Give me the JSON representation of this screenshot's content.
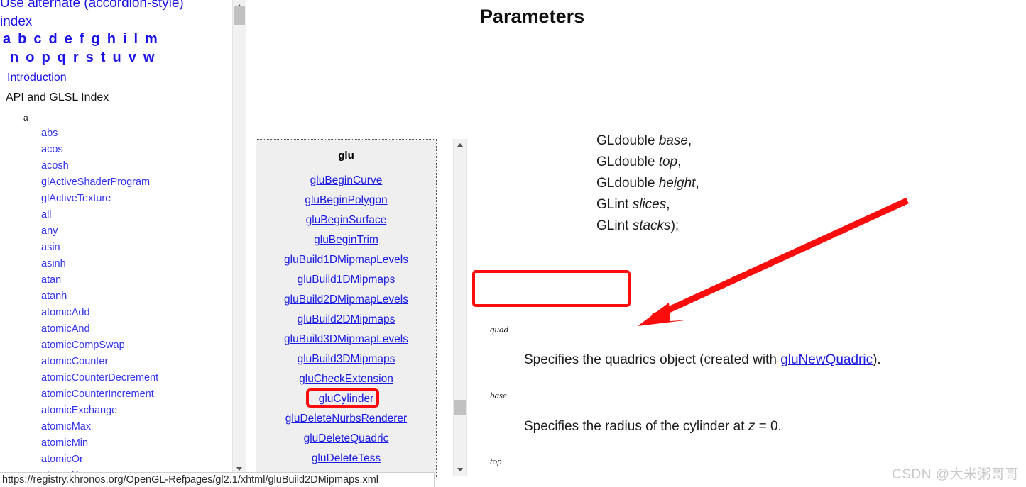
{
  "left_index": {
    "heading_lines": [
      "Use alternate (accordion-style)",
      "index"
    ],
    "alpha_row_1": [
      "a",
      "b",
      "c",
      "d",
      "e",
      "f",
      "g",
      "h",
      "i",
      "l",
      "m"
    ],
    "alpha_row_2": [
      "n",
      "o",
      "p",
      "q",
      "r",
      "s",
      "t",
      "u",
      "v",
      "w"
    ],
    "intro_link": "Introduction",
    "section_title": "API and GLSL Index",
    "letter_group": "a",
    "items": [
      "abs",
      "acos",
      "acosh",
      "glActiveShaderProgram",
      "glActiveTexture",
      "all",
      "any",
      "asin",
      "asinh",
      "atan",
      "atanh",
      "atomicAdd",
      "atomicAnd",
      "atomicCompSwap",
      "atomicCounter",
      "atomicCounterDecrement",
      "atomicCounterIncrement",
      "atomicExchange",
      "atomicMax",
      "atomicMin",
      "atomicOr",
      "atomicXor"
    ]
  },
  "glu_panel": {
    "title": "glu",
    "items": [
      "gluBeginCurve",
      "gluBeginPolygon",
      "gluBeginSurface",
      "gluBeginTrim",
      "gluBuild1DMipmapLevels",
      "gluBuild1DMipmaps",
      "gluBuild2DMipmapLevels",
      "gluBuild2DMipmaps",
      "gluBuild3DMipmapLevels",
      "gluBuild3DMipmaps",
      "gluCheckExtension",
      "gluCylinder",
      "gluDeleteNurbsRenderer",
      "gluDeleteQuadric",
      "gluDeleteTess"
    ],
    "highlighted_item": "gluCylinder"
  },
  "content": {
    "signature_lines": [
      {
        "type": "GLdouble",
        "name": "base",
        "tail": ","
      },
      {
        "type": "GLdouble",
        "name": "top",
        "tail": ","
      },
      {
        "type": "GLdouble",
        "name": "height",
        "tail": ","
      },
      {
        "type": "GLint",
        "name": "slices",
        "tail": ","
      },
      {
        "type": "GLint",
        "name": "stacks",
        "tail": ");"
      }
    ],
    "section_heading": "Parameters",
    "parameters": [
      {
        "name": "quad",
        "desc_prefix": "Specifies the quadrics object (created with ",
        "link": "gluNewQuadric",
        "desc_suffix": ")."
      },
      {
        "name": "base",
        "desc_prefix": "Specifies the radius of the cylinder at ",
        "italic": "z",
        "desc_suffix": " = 0."
      },
      {
        "name": "top",
        "desc_prefix": "",
        "desc_suffix": ""
      }
    ]
  },
  "status_bar": {
    "url": "https://registry.khronos.org/OpenGL-Refpages/gl2.1/xhtml/gluBuild2DMipmaps.xml"
  },
  "watermark": {
    "text": "CSDN @大米粥哥哥"
  },
  "scrollbars": {
    "left": {
      "up_arrow": "scroll-up",
      "down_arrow": "scroll-down"
    },
    "middle": {
      "up_arrow": "scroll-up",
      "down_arrow": "scroll-down"
    }
  },
  "colors": {
    "link": "#1a1ae0",
    "highlight_red": "#fb0d0d",
    "panel_bg": "#efefef",
    "scrollbar_track": "#f1f1f1",
    "scrollbar_thumb": "#c1c1c1",
    "watermark": "#c9c9c9"
  }
}
